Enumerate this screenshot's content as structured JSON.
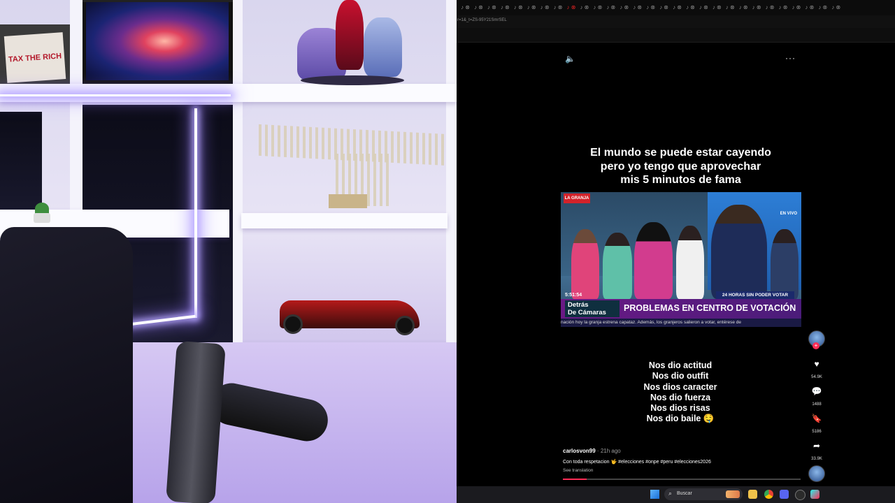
{
  "webcam": {
    "poster_text": "TAX THE RICH"
  },
  "browser": {
    "tab_count": 29,
    "active_tab_index": 8,
    "tab_glyph": "♪ ⊗",
    "top_right_text": "",
    "url": "r=1&_t=ZS-95Y21SmrSEL"
  },
  "video": {
    "volume_icon": "speaker-icon",
    "more_label": "···",
    "caption_top": [
      "El mundo se puede estar cayendo",
      "pero yo tengo que aprovechar",
      "mis 5 minutos de fama"
    ],
    "news": {
      "logo": "LA GRANJA",
      "live": "EN VIVO",
      "time": "5:51:54",
      "hours_tag": "24 HORAS SIN PODER VOTAR",
      "segment": [
        "Detrás",
        "De Cámaras"
      ],
      "headline": "PROBLEMAS EN CENTRO DE VOTACIÓN",
      "ticker": "nación hoy la granja estrena capataz. Además, los granjeros salieron a votar, entérese de"
    },
    "caption_bottom": [
      "Nos dio actitud",
      "Nos dio outfit",
      "Nos dios caracter",
      "Nos dio fuerza",
      "Nos dios risas",
      "Nos dio baile 🤤"
    ],
    "progress_fraction": 0.1
  },
  "rail": {
    "like_count": "54.9K",
    "comment_count": "1488",
    "save_count": "5186",
    "share_count": "33.9K",
    "like_icon": "heart-icon",
    "comment_icon": "comment-icon",
    "save_icon": "bookmark-icon",
    "share_icon": "share-icon"
  },
  "post": {
    "author": "carlosvon99",
    "time": " · 21h ago",
    "description": "Con toda respetacion 🤟 #elecciones #onpe #peru #elecciones2026",
    "translate": "See translation"
  },
  "taskbar": {
    "search_placeholder": "Buscar",
    "apps": [
      "folder",
      "chrome",
      "discord",
      "obs",
      "tiktok"
    ]
  },
  "colors": {
    "accent": "#fe2c55",
    "neon": "#b7a7ff",
    "news_banner": "#6a1a85"
  }
}
